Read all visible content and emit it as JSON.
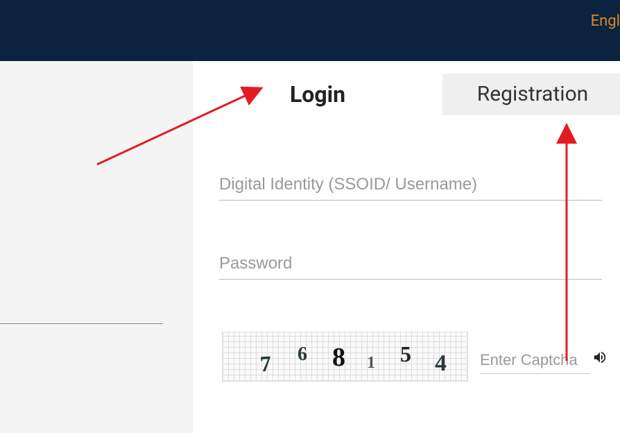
{
  "header": {
    "language": "Engl"
  },
  "tabs": {
    "login": "Login",
    "registration": "Registration"
  },
  "fields": {
    "ssoid_placeholder": "Digital Identity (SSOID/ Username)",
    "password_placeholder": "Password",
    "captcha_placeholder": "Enter Captcha"
  },
  "captcha": {
    "digits": [
      "7",
      "6",
      "8",
      "1",
      "5",
      "4"
    ]
  }
}
